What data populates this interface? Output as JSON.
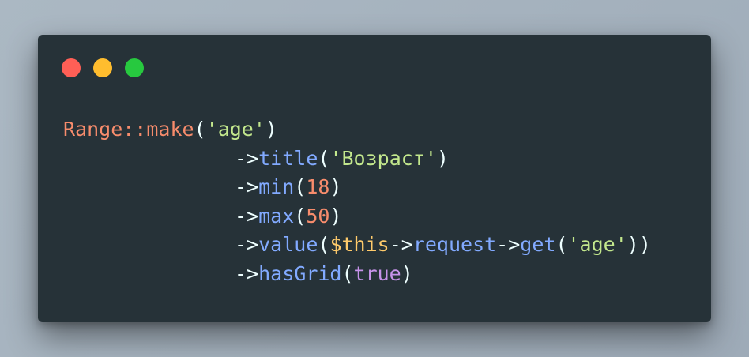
{
  "window": {
    "controls": [
      {
        "name": "close",
        "color": "#ff5f56"
      },
      {
        "name": "minimize",
        "color": "#ffbd2e"
      },
      {
        "name": "maximize",
        "color": "#27c93f"
      }
    ]
  },
  "colors": {
    "background": "#263238",
    "plain": "#eeffff",
    "class": "#f07178",
    "method": "#82aaff",
    "string": "#c3e88d",
    "number": "#f78c6c",
    "variable": "#ffcb6b",
    "keyword": "#c792ea",
    "punct": "#89ddff"
  },
  "code": {
    "lines": [
      {
        "indent": false,
        "tokens": [
          {
            "t": "Range::make",
            "c": "#f78c6c"
          },
          {
            "t": "(",
            "c": "#eeffff"
          },
          {
            "t": "'age'",
            "c": "#c3e88d"
          },
          {
            "t": ")",
            "c": "#eeffff"
          }
        ]
      },
      {
        "indent": true,
        "tokens": [
          {
            "t": "->",
            "c": "#eeffff"
          },
          {
            "t": "title",
            "c": "#82aaff"
          },
          {
            "t": "(",
            "c": "#eeffff"
          },
          {
            "t": "'Возраст'",
            "c": "#c3e88d"
          },
          {
            "t": ")",
            "c": "#eeffff"
          }
        ]
      },
      {
        "indent": true,
        "tokens": [
          {
            "t": "->",
            "c": "#eeffff"
          },
          {
            "t": "min",
            "c": "#82aaff"
          },
          {
            "t": "(",
            "c": "#eeffff"
          },
          {
            "t": "18",
            "c": "#f78c6c"
          },
          {
            "t": ")",
            "c": "#eeffff"
          }
        ]
      },
      {
        "indent": true,
        "tokens": [
          {
            "t": "->",
            "c": "#eeffff"
          },
          {
            "t": "max",
            "c": "#82aaff"
          },
          {
            "t": "(",
            "c": "#eeffff"
          },
          {
            "t": "50",
            "c": "#f78c6c"
          },
          {
            "t": ")",
            "c": "#eeffff"
          }
        ]
      },
      {
        "indent": true,
        "tokens": [
          {
            "t": "->",
            "c": "#eeffff"
          },
          {
            "t": "value",
            "c": "#82aaff"
          },
          {
            "t": "(",
            "c": "#eeffff"
          },
          {
            "t": "$this",
            "c": "#ffcb6b"
          },
          {
            "t": "->",
            "c": "#eeffff"
          },
          {
            "t": "request",
            "c": "#82aaff"
          },
          {
            "t": "->",
            "c": "#eeffff"
          },
          {
            "t": "get",
            "c": "#82aaff"
          },
          {
            "t": "(",
            "c": "#eeffff"
          },
          {
            "t": "'age'",
            "c": "#c3e88d"
          },
          {
            "t": "))",
            "c": "#eeffff"
          }
        ]
      },
      {
        "indent": true,
        "tokens": [
          {
            "t": "->",
            "c": "#eeffff"
          },
          {
            "t": "hasGrid",
            "c": "#82aaff"
          },
          {
            "t": "(",
            "c": "#eeffff"
          },
          {
            "t": "true",
            "c": "#c792ea"
          },
          {
            "t": ")",
            "c": "#eeffff"
          }
        ]
      }
    ]
  }
}
